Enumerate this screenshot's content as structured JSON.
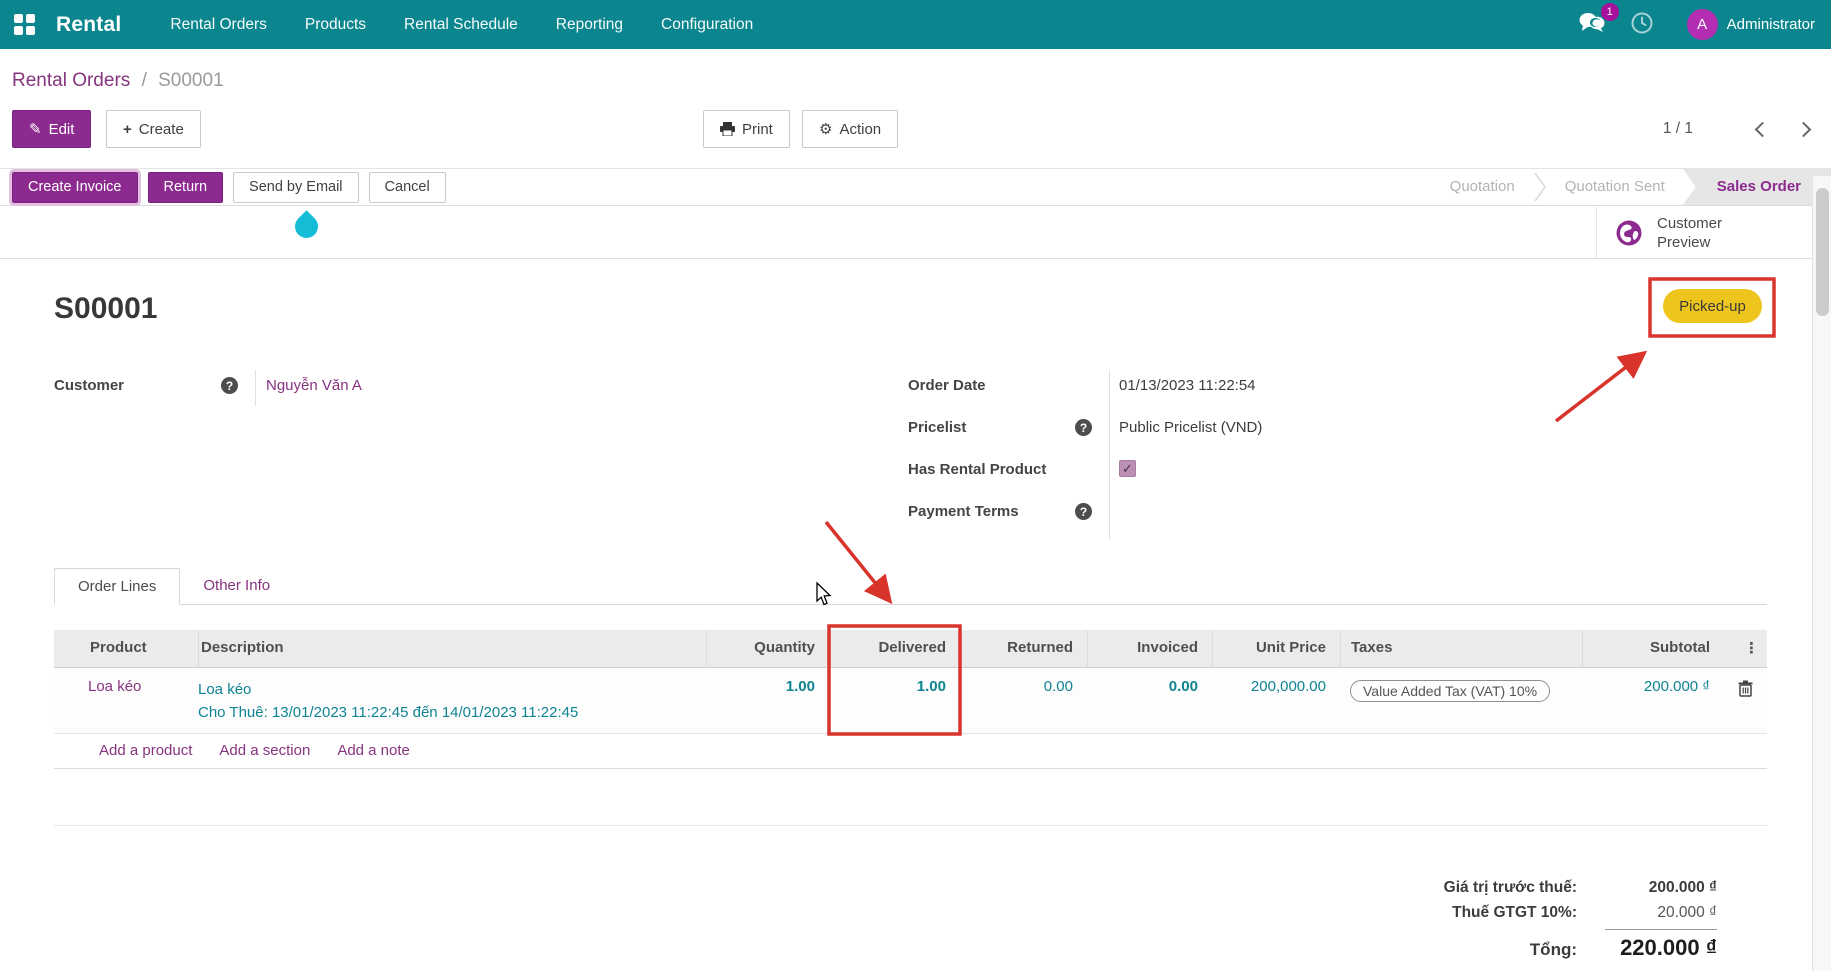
{
  "navbar": {
    "app_name": "Rental",
    "menus": [
      "Rental Orders",
      "Products",
      "Rental Schedule",
      "Reporting",
      "Configuration"
    ],
    "message_badge": "1",
    "user_initial": "A",
    "user_name": "Administrator"
  },
  "breadcrumb": {
    "parent": "Rental Orders",
    "separator": "/",
    "current": "S00001"
  },
  "control_panel": {
    "edit": "Edit",
    "create": "Create",
    "print": "Print",
    "action": "Action",
    "pager": "1 / 1"
  },
  "statusbar": {
    "buttons": [
      "Create Invoice",
      "Return",
      "Send by Email",
      "Cancel"
    ],
    "steps": [
      "Quotation",
      "Quotation Sent",
      "Sales Order"
    ],
    "active_step": "Sales Order"
  },
  "preview": {
    "customer_preview_label": "Customer Preview"
  },
  "sheet": {
    "title": "S00001",
    "status_badge": "Picked-up",
    "fields": {
      "customer": {
        "label": "Customer",
        "value": "Nguyễn Văn A"
      },
      "order_date": {
        "label": "Order Date",
        "value": "01/13/2023 11:22:54"
      },
      "pricelist": {
        "label": "Pricelist",
        "value": "Public Pricelist (VND)"
      },
      "has_rental_product": {
        "label": "Has Rental Product",
        "checked": true
      },
      "payment_terms": {
        "label": "Payment Terms",
        "value": ""
      }
    },
    "tabs": [
      {
        "label": "Order Lines",
        "active": true
      },
      {
        "label": "Other Info",
        "active": false
      }
    ],
    "order_lines": {
      "columns": [
        "Product",
        "Description",
        "Quantity",
        "Delivered",
        "Returned",
        "Invoiced",
        "Unit Price",
        "Taxes",
        "Subtotal"
      ],
      "rows": [
        {
          "product": "Loa kéo",
          "description": "Loa kéo",
          "rental_period": "Cho Thuê: 13/01/2023 11:22:45 đến 14/01/2023 11:22:45",
          "quantity": "1.00",
          "delivered": "1.00",
          "returned": "0.00",
          "invoiced": "0.00",
          "unit_price": "200,000.00",
          "taxes": "Value Added Tax (VAT) 10%",
          "subtotal": "200.000 ₫"
        }
      ],
      "footer_links": [
        "Add a product",
        "Add a section",
        "Add a note"
      ]
    },
    "totals": {
      "untaxed_label": "Giá trị trước thuế:",
      "untaxed_value": "200.000 ₫",
      "tax_label": "Thuế GTGT 10%:",
      "tax_value": "20.000 ₫",
      "total_label": "Tổng:",
      "total_value": "220.000 ₫"
    }
  },
  "icons": {
    "help": "?",
    "check": "✓",
    "plus": "+",
    "pencil": "✎",
    "gear": "⚙",
    "dots": "⋮"
  },
  "colors": {
    "navbar_teal": "#0b868e",
    "primary_purple": "#8c2a8f",
    "badge_yellow": "#eec51c",
    "annotation_red": "#d9342b",
    "amount_teal": "#0e8492",
    "droplet_cyan": "#14bcd6"
  }
}
